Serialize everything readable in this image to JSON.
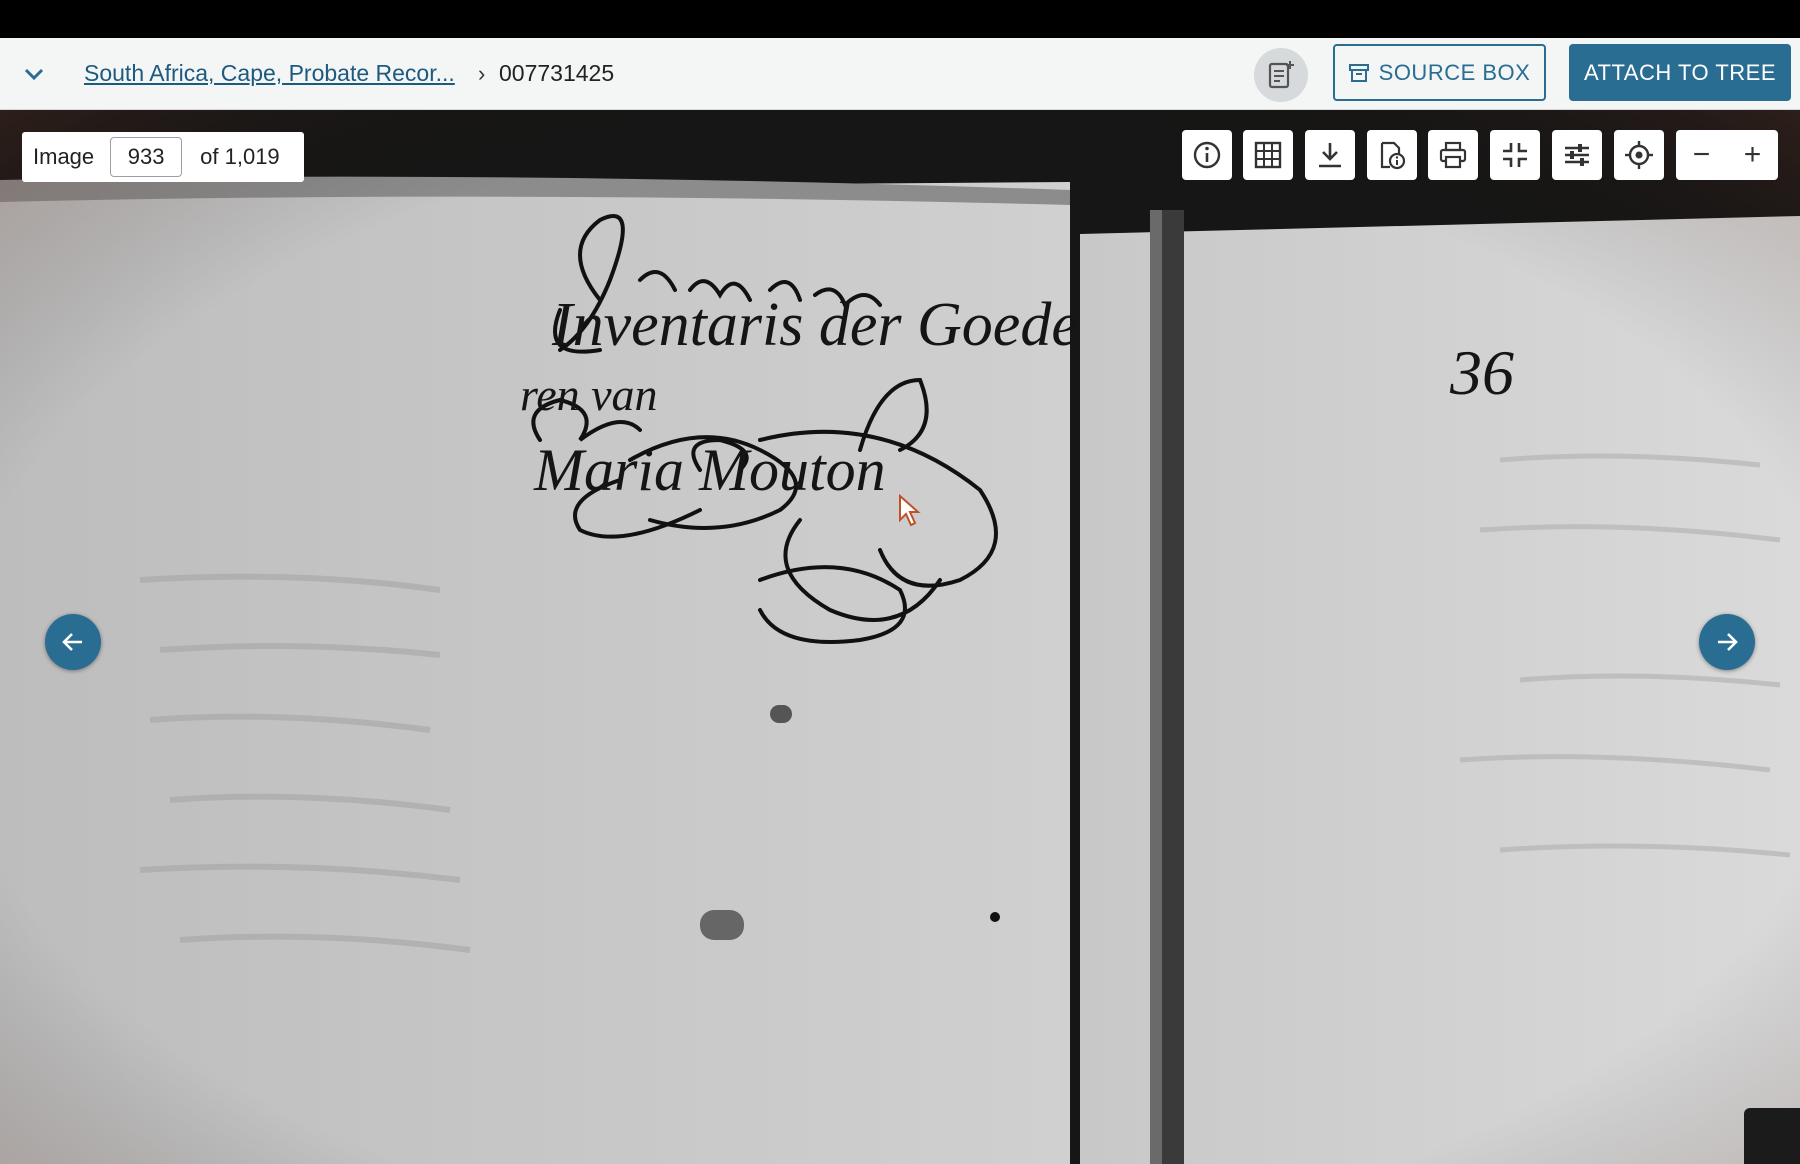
{
  "breadcrumb": {
    "collection": "South Africa, Cape, Probate Recor...",
    "separator": "›",
    "film_number": "007731425"
  },
  "header": {
    "source_box_label": "SOURCE BOX",
    "attach_label": "ATTACH TO TREE"
  },
  "viewer": {
    "image_label": "Image",
    "current_image": "933",
    "total_label": "of 1,019"
  },
  "toolbar": {
    "tools": [
      "info-icon",
      "grid-icon",
      "download-icon",
      "record-info-icon",
      "print-icon",
      "fit-screen-icon",
      "adjust-icon",
      "locate-icon"
    ],
    "zoom_out": "−",
    "zoom_in": "+"
  },
  "document_text": {
    "line1": "Inventaris der Goede",
    "line2": "ren van",
    "line3": "Maria Mouton",
    "page_number": "36"
  },
  "colors": {
    "accent": "#2a6d93",
    "link": "#1d5a80",
    "header_bg": "#f4f5f5"
  }
}
